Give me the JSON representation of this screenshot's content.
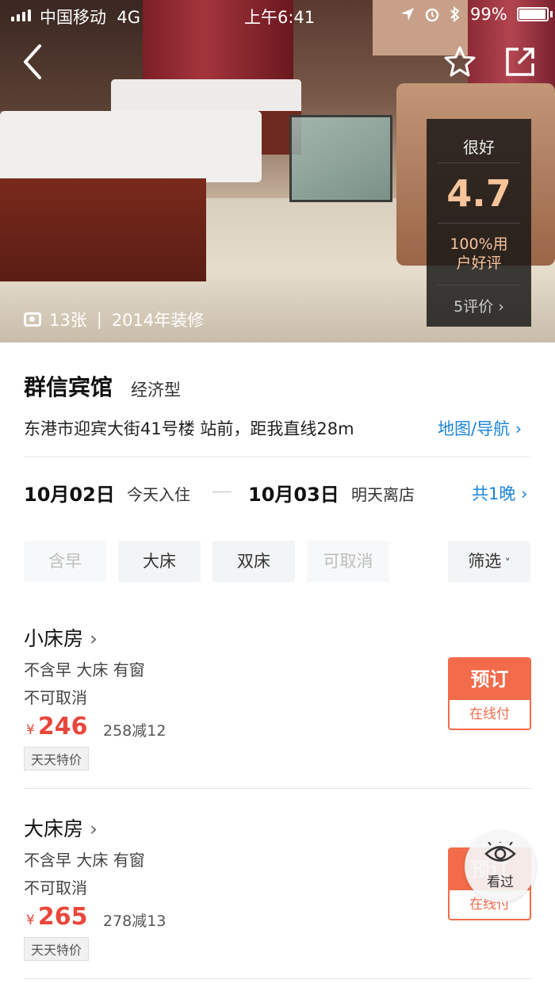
{
  "status_bar": {
    "carrier": "中国移动",
    "network": "4G",
    "time": "上午6:41",
    "battery": "99%"
  },
  "hero": {
    "photo_count": "13张",
    "renovation": "2014年装修",
    "rating": {
      "label": "很好",
      "score": "4.7",
      "percent": "100%用户好评",
      "reviews": "5评价"
    }
  },
  "hotel": {
    "name": "群信宾馆",
    "type": "经济型",
    "address": "东港市迎宾大街41号楼 站前，距我直线28m",
    "map_link": "地图/导航"
  },
  "dates": {
    "check_in": "10月02日",
    "check_in_label": "今天入住",
    "check_out": "10月03日",
    "check_out_label": "明天离店",
    "nights": "共1晚"
  },
  "filters": {
    "chips": [
      "含早",
      "大床",
      "双床",
      "可取消"
    ],
    "filter_label": "筛选"
  },
  "rooms": [
    {
      "name": "小床房",
      "tags": "不含早 大床 有窗",
      "cancel": "不可取消",
      "currency": "¥",
      "price": "246",
      "discount": "258减12",
      "badge": "天天特价",
      "book_label": "预订",
      "pay_label": "在线付"
    },
    {
      "name": "大床房",
      "tags": "不含早 大床 有窗",
      "cancel": "不可取消",
      "currency": "¥",
      "price": "265",
      "discount": "278减13",
      "badge": "天天特价",
      "book_label": "预订",
      "pay_label": "在线付"
    }
  ],
  "viewed": {
    "label": "看过"
  },
  "colors": {
    "accent_blue": "#1b84d8",
    "price_red": "#e8473b",
    "book_orange": "#f26b4a",
    "rating_orange": "#f8c49a"
  }
}
